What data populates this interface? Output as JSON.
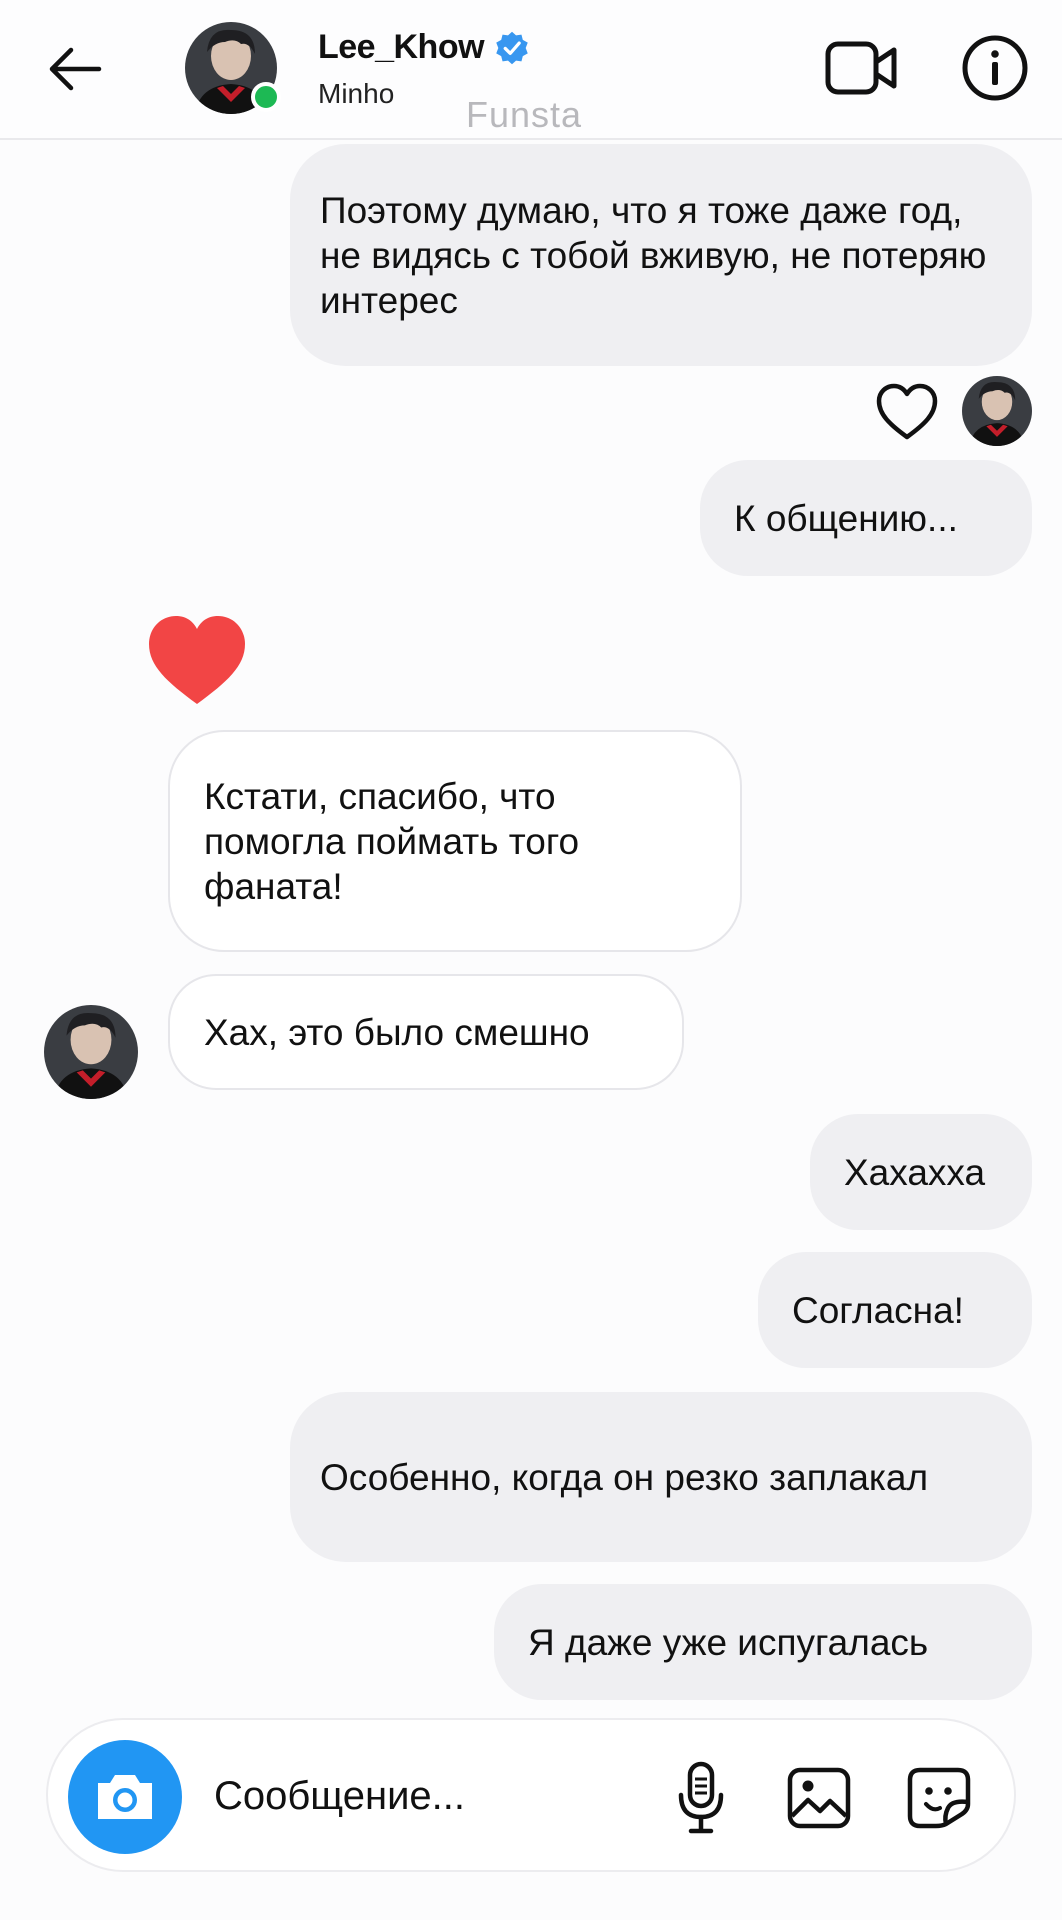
{
  "header": {
    "title": "Lee_Khow",
    "subtitle": "Minho",
    "watermark": "Funsta",
    "verified": true,
    "online": true,
    "icons": {
      "back": "arrow-left-icon",
      "video": "video-camera-icon",
      "info": "info-icon"
    }
  },
  "messages": [
    {
      "side": "out",
      "text": "Поэтому думаю, что я тоже даже год, не видясь с тобой вживую, не потеряю интерес"
    },
    {
      "side": "out",
      "text": "К общению..."
    },
    {
      "side": "in",
      "text": "Кстати, спасибо, что помогла поймать того фаната!"
    },
    {
      "side": "in",
      "text": "Хах, это было смешно"
    },
    {
      "side": "out",
      "text": "Хахахха"
    },
    {
      "side": "out",
      "text": "Согласна!"
    },
    {
      "side": "out",
      "text": "Особенно, когда он резко заплакал"
    },
    {
      "side": "out",
      "text": "Я даже уже испугалась"
    }
  ],
  "reactions": {
    "like_outline_icon": "heart-outline-icon",
    "heart_icon": "heart-icon"
  },
  "composer": {
    "placeholder": "Сообщение...",
    "icons": [
      "camera-icon",
      "microphone-icon",
      "gallery-icon",
      "sticker-icon"
    ]
  },
  "colors": {
    "accent_blue": "#2196f3",
    "verified_blue": "#3897f0",
    "online_green": "#1db954",
    "heart_red": "#f24545",
    "outgoing_bubble": "#efeff2"
  }
}
